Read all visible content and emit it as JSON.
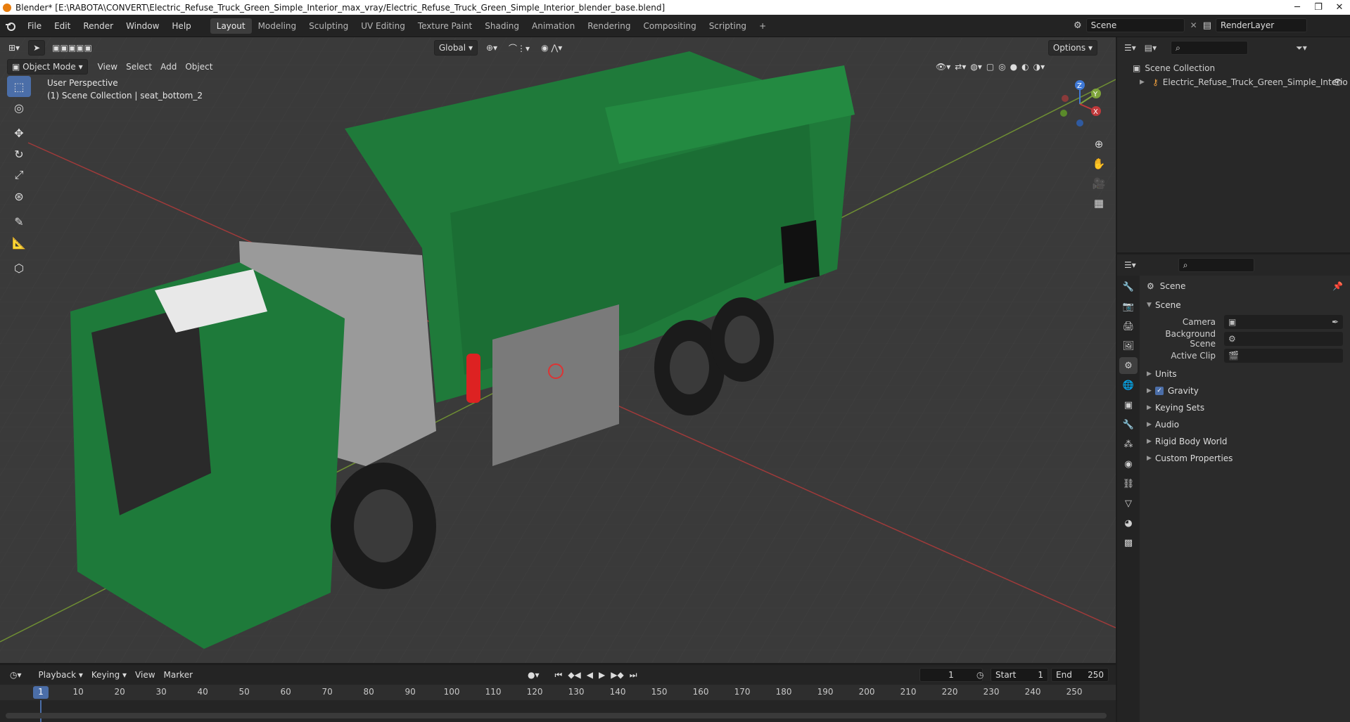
{
  "title_bar": {
    "text": "Blender* [E:\\RABOTA\\CONVERT\\Electric_Refuse_Truck_Green_Simple_Interior_max_vray/Electric_Refuse_Truck_Green_Simple_Interior_blender_base.blend]"
  },
  "menu": [
    "File",
    "Edit",
    "Render",
    "Window",
    "Help"
  ],
  "workspaces": [
    "Layout",
    "Modeling",
    "Sculpting",
    "UV Editing",
    "Texture Paint",
    "Shading",
    "Animation",
    "Rendering",
    "Compositing",
    "Scripting"
  ],
  "scene_field": "Scene",
  "render_layer": "RenderLayer",
  "viewport": {
    "mode": "Object Mode",
    "menus": [
      "View",
      "Select",
      "Add",
      "Object"
    ],
    "orientation": "Global",
    "options": "Options",
    "perspective": "User Perspective",
    "collection_info": "(1) Scene Collection | seat_bottom_2",
    "gizmo_labels": {
      "z": "Z",
      "y": "Y",
      "x": "X"
    }
  },
  "outliner": {
    "root": "Scene Collection",
    "items": [
      "Electric_Refuse_Truck_Green_Simple_Interio"
    ]
  },
  "properties": {
    "header": "Scene",
    "section": "Scene",
    "fields": [
      {
        "label": "Camera",
        "value": ""
      },
      {
        "label": "Background Scene",
        "value": ""
      },
      {
        "label": "Active Clip",
        "value": ""
      }
    ],
    "panels": [
      "Units",
      "Gravity",
      "Keying Sets",
      "Audio",
      "Rigid Body World",
      "Custom Properties"
    ],
    "gravity_checked": true
  },
  "timeline": {
    "menus": [
      "Playback",
      "Keying",
      "View",
      "Marker"
    ],
    "current_frame": "1",
    "start_label": "Start",
    "start": "1",
    "end_label": "End",
    "end": "250",
    "ruler": [
      "1",
      "10",
      "20",
      "30",
      "40",
      "50",
      "60",
      "70",
      "80",
      "90",
      "100",
      "110",
      "120",
      "130",
      "140",
      "150",
      "160",
      "170",
      "180",
      "190",
      "200",
      "210",
      "220",
      "230",
      "240",
      "250"
    ]
  },
  "colors": {
    "accent": "#4b6ea8",
    "truck_green": "#1a7a3a",
    "x_axis": "#c0393b",
    "y_axis": "#7ea33a",
    "z_axis": "#3f79d6"
  }
}
